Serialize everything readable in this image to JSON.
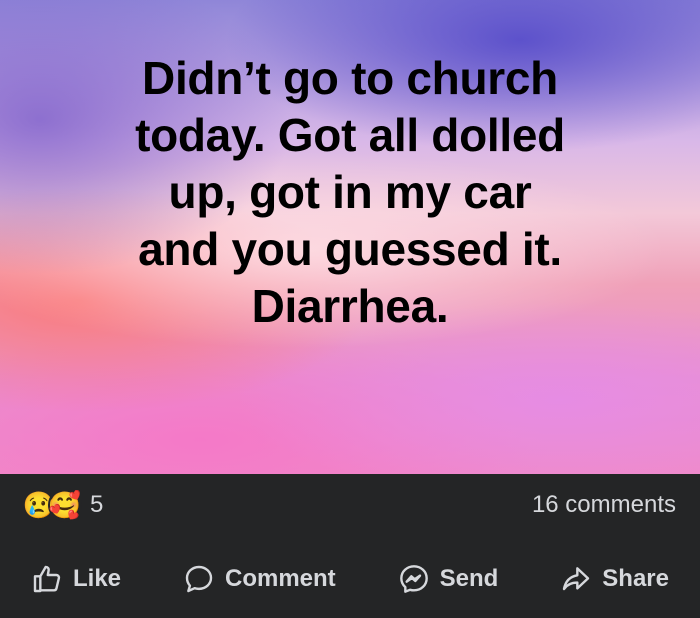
{
  "post": {
    "text": "Didn’t go to church\ntoday. Got all dolled\nup, got in my car\nand you guessed it.\nDiarrhea."
  },
  "stats": {
    "reactions": [
      "sad-face-icon",
      "care-face-icon"
    ],
    "reaction_count": "5",
    "comments_label": "16 comments"
  },
  "actions": {
    "like": "Like",
    "comment": "Comment",
    "send": "Send",
    "share": "Share"
  },
  "colors": {
    "bar_background": "#242526",
    "bar_text": "#d6d8dc"
  }
}
